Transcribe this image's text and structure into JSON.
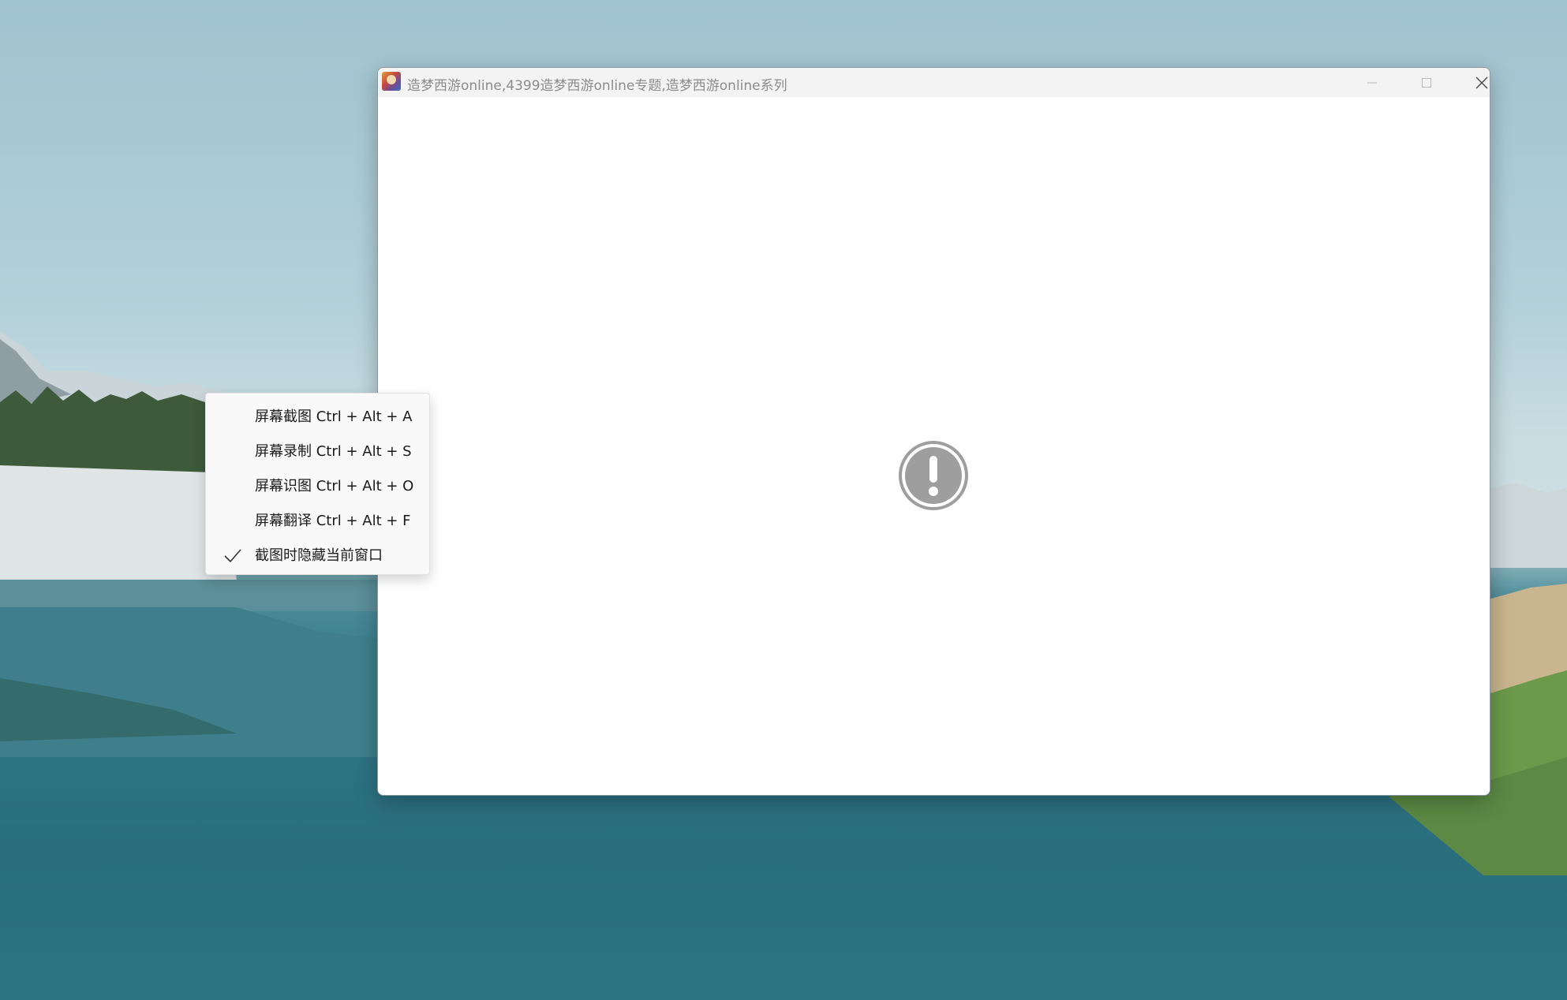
{
  "window": {
    "title": "造梦西游online,4399造梦西游online专题,造梦西游online系列",
    "icon": "game-app-icon",
    "caption_buttons": [
      "minimize-icon",
      "maximize-icon",
      "close-icon"
    ]
  },
  "content": {
    "status_icon": "exclamation-circle-icon",
    "status_icon_color": "#9e9e9e"
  },
  "context_menu": {
    "items": [
      {
        "label": "屏幕截图 Ctrl + Alt + A",
        "checked": false
      },
      {
        "label": "屏幕录制 Ctrl + Alt + S",
        "checked": false
      },
      {
        "label": "屏幕识图 Ctrl + Alt + O",
        "checked": false
      },
      {
        "label": "屏幕翻译 Ctrl + Alt + F",
        "checked": false
      },
      {
        "label": "截图时隐藏当前窗口",
        "checked": true
      }
    ]
  },
  "colors": {
    "title_bar": "#f3f3f3",
    "title_text": "#8c8c8c",
    "menu_background": "#f9f9f9"
  }
}
